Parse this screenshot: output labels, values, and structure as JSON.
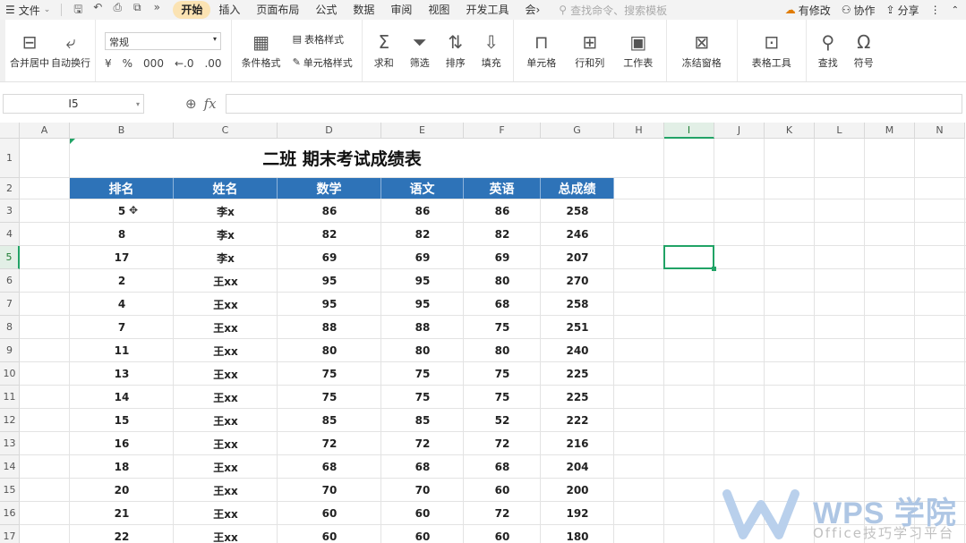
{
  "menubar": {
    "file_label": "文件",
    "tabs": [
      "开始",
      "插入",
      "页面布局",
      "公式",
      "数据",
      "审阅",
      "视图",
      "开发工具",
      "会"
    ],
    "active_tab": "开始",
    "search_placeholder": "查找命令、搜索模板",
    "modify_label": "有修改",
    "collab_label": "协作",
    "share_label": "分享"
  },
  "ribbon": {
    "merge_label": "合并居中",
    "wrap_label": "自动换行",
    "format_select": "常规",
    "currency": "¥",
    "percent": "%",
    "thousands": "000",
    "inc_dec": "←.0",
    "dec_dec": ".00",
    "cond_format_label": "条件格式",
    "table_style_label": "表格样式",
    "cell_style_label": "单元格样式",
    "sum_label": "求和",
    "filter_label": "筛选",
    "sort_label": "排序",
    "fill_label": "填充",
    "cell_label": "单元格",
    "rowcol_label": "行和列",
    "sheet_label": "工作表",
    "freeze_label": "冻结窗格",
    "tabletool_label": "表格工具",
    "find_label": "查找",
    "symbol_label": "符号"
  },
  "formula_bar": {
    "name_box": "I5",
    "formula": ""
  },
  "columns": [
    "A",
    "B",
    "C",
    "D",
    "E",
    "F",
    "G",
    "H",
    "I",
    "J",
    "K",
    "L",
    "M",
    "N"
  ],
  "rows": [
    "1",
    "2",
    "3",
    "4",
    "5",
    "6",
    "7",
    "8",
    "9",
    "10",
    "11",
    "12",
    "13",
    "14",
    "15",
    "16",
    "17"
  ],
  "sheet": {
    "title": "二班 期末考试成绩表",
    "headers": [
      "排名",
      "姓名",
      "数学",
      "语文",
      "英语",
      "总成绩"
    ],
    "data": [
      [
        "5",
        "李x",
        "86",
        "86",
        "86",
        "258"
      ],
      [
        "8",
        "李x",
        "82",
        "82",
        "82",
        "246"
      ],
      [
        "17",
        "李x",
        "69",
        "69",
        "69",
        "207"
      ],
      [
        "2",
        "王xx",
        "95",
        "95",
        "80",
        "270"
      ],
      [
        "4",
        "王xx",
        "95",
        "95",
        "68",
        "258"
      ],
      [
        "7",
        "王xx",
        "88",
        "88",
        "75",
        "251"
      ],
      [
        "11",
        "王xx",
        "80",
        "80",
        "80",
        "240"
      ],
      [
        "13",
        "王xx",
        "75",
        "75",
        "75",
        "225"
      ],
      [
        "14",
        "王xx",
        "75",
        "75",
        "75",
        "225"
      ],
      [
        "15",
        "王xx",
        "85",
        "85",
        "52",
        "222"
      ],
      [
        "16",
        "王xx",
        "72",
        "72",
        "72",
        "216"
      ],
      [
        "18",
        "王xx",
        "68",
        "68",
        "68",
        "204"
      ],
      [
        "20",
        "王xx",
        "70",
        "70",
        "60",
        "200"
      ],
      [
        "21",
        "王xx",
        "60",
        "60",
        "72",
        "192"
      ],
      [
        "22",
        "王xx",
        "60",
        "60",
        "60",
        "180"
      ]
    ]
  },
  "watermark": {
    "brand": "WPS 学院",
    "slogan": "Office技巧学习平台"
  },
  "colors": {
    "header_blue": "#2e73b8",
    "select_green": "#21a366",
    "active_tab": "#fbe3b3"
  }
}
